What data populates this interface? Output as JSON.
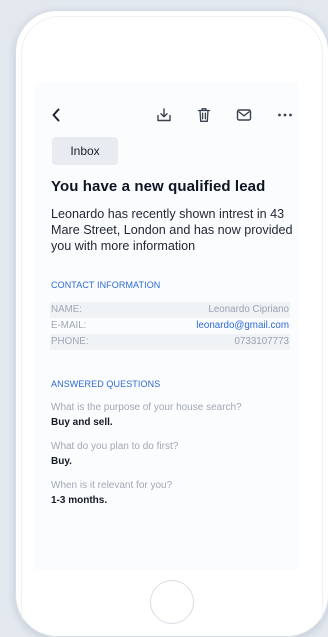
{
  "toolbar": {
    "icons": [
      "back-chevron-icon",
      "download-tray-icon",
      "trash-icon",
      "mail-icon",
      "more-dots-icon"
    ]
  },
  "badge": {
    "label": "Inbox"
  },
  "message": {
    "title": "You have a new qualified lead",
    "intro": "Leonardo has recently shown intrest in 43 Mare Street, London and has now provided you with more information"
  },
  "contact": {
    "heading": "CONTACT INFORMATION",
    "rows": [
      {
        "label": "NAME:",
        "value": "Leonardo Cipriano"
      },
      {
        "label": "E-MAIL:",
        "value": "leonardo@gmail.com"
      },
      {
        "label": "PHONE:",
        "value": "0733107773"
      }
    ]
  },
  "questions": {
    "heading": "ANSWERED QUESTIONS",
    "items": [
      {
        "question": "What is the purpose of your house search?",
        "answer": "Buy and sell."
      },
      {
        "question": "What do you plan to do first?",
        "answer": "Buy."
      },
      {
        "question": "When is it relevant for you?",
        "answer": "1-3 months."
      }
    ]
  },
  "colors": {
    "accent": "#2d6ad6",
    "title": "#0d1422",
    "muted": "#a0a8b4",
    "badge_bg": "#e8ecf1",
    "background": "#e3e8ef"
  }
}
